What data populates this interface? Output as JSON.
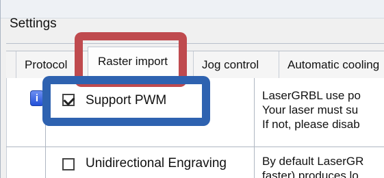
{
  "window": {
    "title": "Settings"
  },
  "tabs": [
    {
      "label": "Protocol"
    },
    {
      "label": "Raster import"
    },
    {
      "label": "Jog control"
    },
    {
      "label": "Automatic cooling"
    }
  ],
  "options": [
    {
      "label": "Support PWM",
      "checked": true,
      "has_info_icon": true,
      "info_icon_text": "i",
      "description_lines": [
        "LaserGRBL use po",
        "Your laser must su",
        "If not, please disab"
      ]
    },
    {
      "label": "Unidirectional Engraving",
      "checked": false,
      "has_info_icon": false,
      "description_lines": [
        "By default LaserGR",
        "faster) produces lo"
      ]
    }
  ],
  "annotations": {
    "red_highlight_color": "#bf4a4e",
    "blue_highlight_color": "#2e62b0"
  }
}
